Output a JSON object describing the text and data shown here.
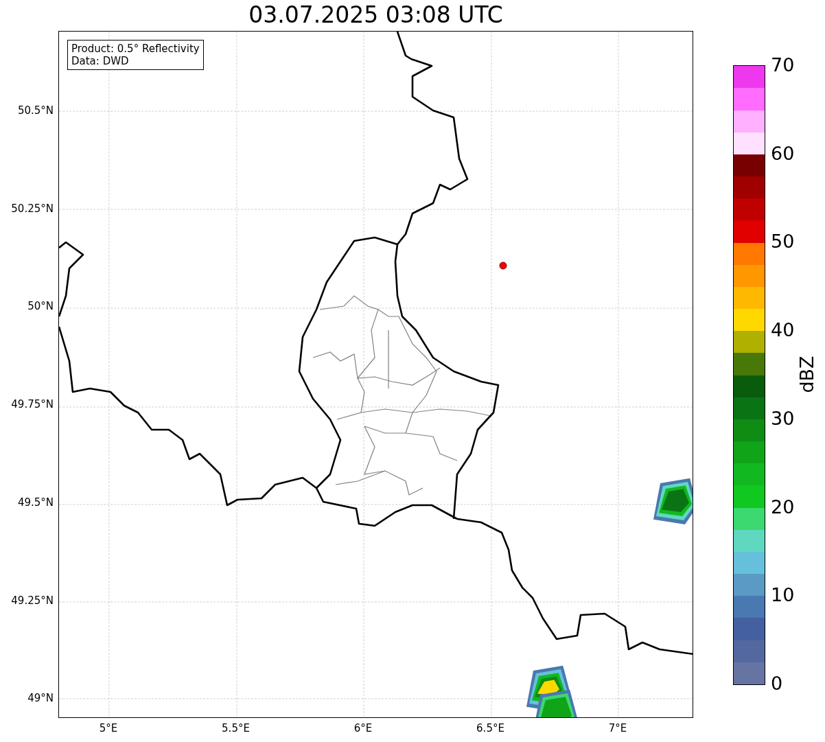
{
  "title": "03.07.2025 03:08 UTC",
  "info_box": {
    "lines": [
      "Product: 0.5° Reflectivity",
      "Data: DWD"
    ]
  },
  "lat_ticks": [
    "50.5°N",
    "50.25°N",
    "50°N",
    "49.75°N",
    "49.5°N",
    "49.25°N",
    "49°N"
  ],
  "lon_ticks": [
    "5°E",
    "5.5°E",
    "6°E",
    "6.5°E",
    "7°E"
  ],
  "colorbar": {
    "label": "dBZ",
    "ticks": [
      "70",
      "60",
      "50",
      "40",
      "30",
      "20",
      "10",
      "0"
    ],
    "segments": [
      {
        "color": "#6674a4"
      },
      {
        "color": "#5468a0"
      },
      {
        "color": "#4560a0"
      },
      {
        "color": "#4a78b0"
      },
      {
        "color": "#5a9ac4"
      },
      {
        "color": "#66c0dc"
      },
      {
        "color": "#60d8c0"
      },
      {
        "color": "#3cd870"
      },
      {
        "color": "#10c820"
      },
      {
        "color": "#12b820"
      },
      {
        "color": "#10a418"
      },
      {
        "color": "#0e8c14"
      },
      {
        "color": "#0a7414"
      },
      {
        "color": "#085c0c"
      },
      {
        "color": "#487808"
      },
      {
        "color": "#b0b000"
      },
      {
        "color": "#ffd800"
      },
      {
        "color": "#ffb800"
      },
      {
        "color": "#ff9800"
      },
      {
        "color": "#ff7800"
      },
      {
        "color": "#e00000"
      },
      {
        "color": "#c00000"
      },
      {
        "color": "#a00000"
      },
      {
        "color": "#780000"
      },
      {
        "color": "#ffe0ff"
      },
      {
        "color": "#ffb0ff"
      },
      {
        "color": "#ff6cff"
      },
      {
        "color": "#ee38ee"
      }
    ]
  }
}
